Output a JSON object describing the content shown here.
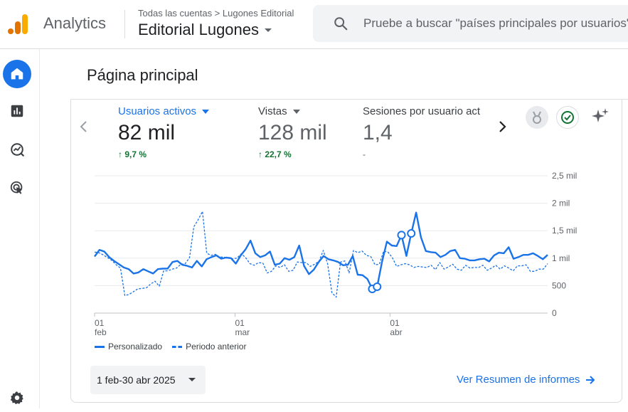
{
  "header": {
    "app_name": "Analytics",
    "breadcrumb": "Todas las cuentas > Lugones Editorial",
    "property_name": "Editorial Lugones",
    "search_placeholder": "Pruebe a buscar \"países principales por usuarios\""
  },
  "sidebar": {
    "items": [
      {
        "name": "home-icon",
        "active": true
      },
      {
        "name": "reports-icon",
        "active": false
      },
      {
        "name": "explore-icon",
        "active": false
      },
      {
        "name": "advertising-icon",
        "active": false
      },
      {
        "name": "settings-icon",
        "active": false
      }
    ]
  },
  "page": {
    "title": "Página principal"
  },
  "metrics": [
    {
      "label": "Usuarios activos",
      "value": "82 mil",
      "change": "↑ 9,7 %"
    },
    {
      "label": "Vistas",
      "value": "128 mil",
      "change": "↑ 22,7 %"
    },
    {
      "label": "Sesiones por usuario act",
      "value": "1,4",
      "change": "-"
    }
  ],
  "colors": {
    "accent": "#1a73e8",
    "positive": "#137333"
  },
  "chart_data": {
    "type": "line",
    "x_tick_labels": [
      {
        "day": "01",
        "month": "feb"
      },
      {
        "day": "01",
        "month": "mar"
      },
      {
        "day": "01",
        "month": "abr"
      }
    ],
    "y_tick_labels": [
      "0",
      "500",
      "1 mil",
      "1,5 mil",
      "2 mil",
      "2,5 mil"
    ],
    "ylim": [
      0,
      2500
    ],
    "grid": true,
    "legend": "bottom-left",
    "series": [
      {
        "name": "Personalizado",
        "style": "solid",
        "values": [
          1030,
          1150,
          1120,
          1020,
          950,
          890,
          830,
          800,
          720,
          740,
          800,
          760,
          720,
          800,
          810,
          810,
          930,
          950,
          880,
          860,
          830,
          950,
          850,
          980,
          1020,
          1050,
          990,
          1010,
          1000,
          900,
          1050,
          1160,
          1320,
          1090,
          1020,
          1050,
          1120,
          880,
          900,
          1000,
          970,
          1020,
          1230,
          860,
          710,
          790,
          930,
          1040,
          980,
          960,
          930,
          870,
          880,
          1040,
          700,
          690,
          620,
          440,
          480,
          930,
          1300,
          1230,
          1220,
          1420,
          1040,
          1450,
          1830,
          1380,
          1130,
          1110,
          1100,
          1020,
          1060,
          1130,
          1150,
          1000,
          990,
          960,
          960,
          980,
          990,
          940,
          1050,
          1100,
          1090,
          1200,
          990,
          1020,
          1060,
          1060,
          1090,
          1040,
          980,
          1060
        ]
      },
      {
        "name": "Periodo anterior",
        "style": "dashed",
        "values": [
          1110,
          1100,
          1060,
          1010,
          960,
          880,
          820,
          320,
          340,
          390,
          440,
          450,
          460,
          530,
          580,
          490,
          770,
          770,
          800,
          820,
          890,
          900,
          1010,
          1570,
          1700,
          1850,
          1090,
          1050,
          1070,
          1020,
          1020,
          1000,
          990,
          1000,
          1080,
          1010,
          900,
          870,
          920,
          910,
          730,
          760,
          860,
          830,
          880,
          760,
          780,
          930,
          920,
          920,
          850,
          890,
          940,
          1140,
          900,
          370,
          290,
          930,
          950,
          730,
          1140,
          1100,
          1130,
          1050,
          1030,
          880,
          890,
          1130,
          1110,
          1010,
          850,
          880,
          900,
          880,
          830,
          850,
          840,
          830,
          870,
          790,
          920,
          800,
          840,
          890,
          800,
          780,
          870,
          820,
          830,
          830,
          870,
          780,
          820,
          870,
          800,
          860,
          820,
          770,
          860,
          860,
          880,
          760,
          760,
          800,
          800,
          900
        ]
      }
    ]
  },
  "legend": {
    "solid_label": "Personalizado",
    "dashed_label": "Periodo anterior"
  },
  "footer": {
    "date_range": "1 feb-30 abr 2025",
    "report_link": "Ver Resumen de informes"
  }
}
